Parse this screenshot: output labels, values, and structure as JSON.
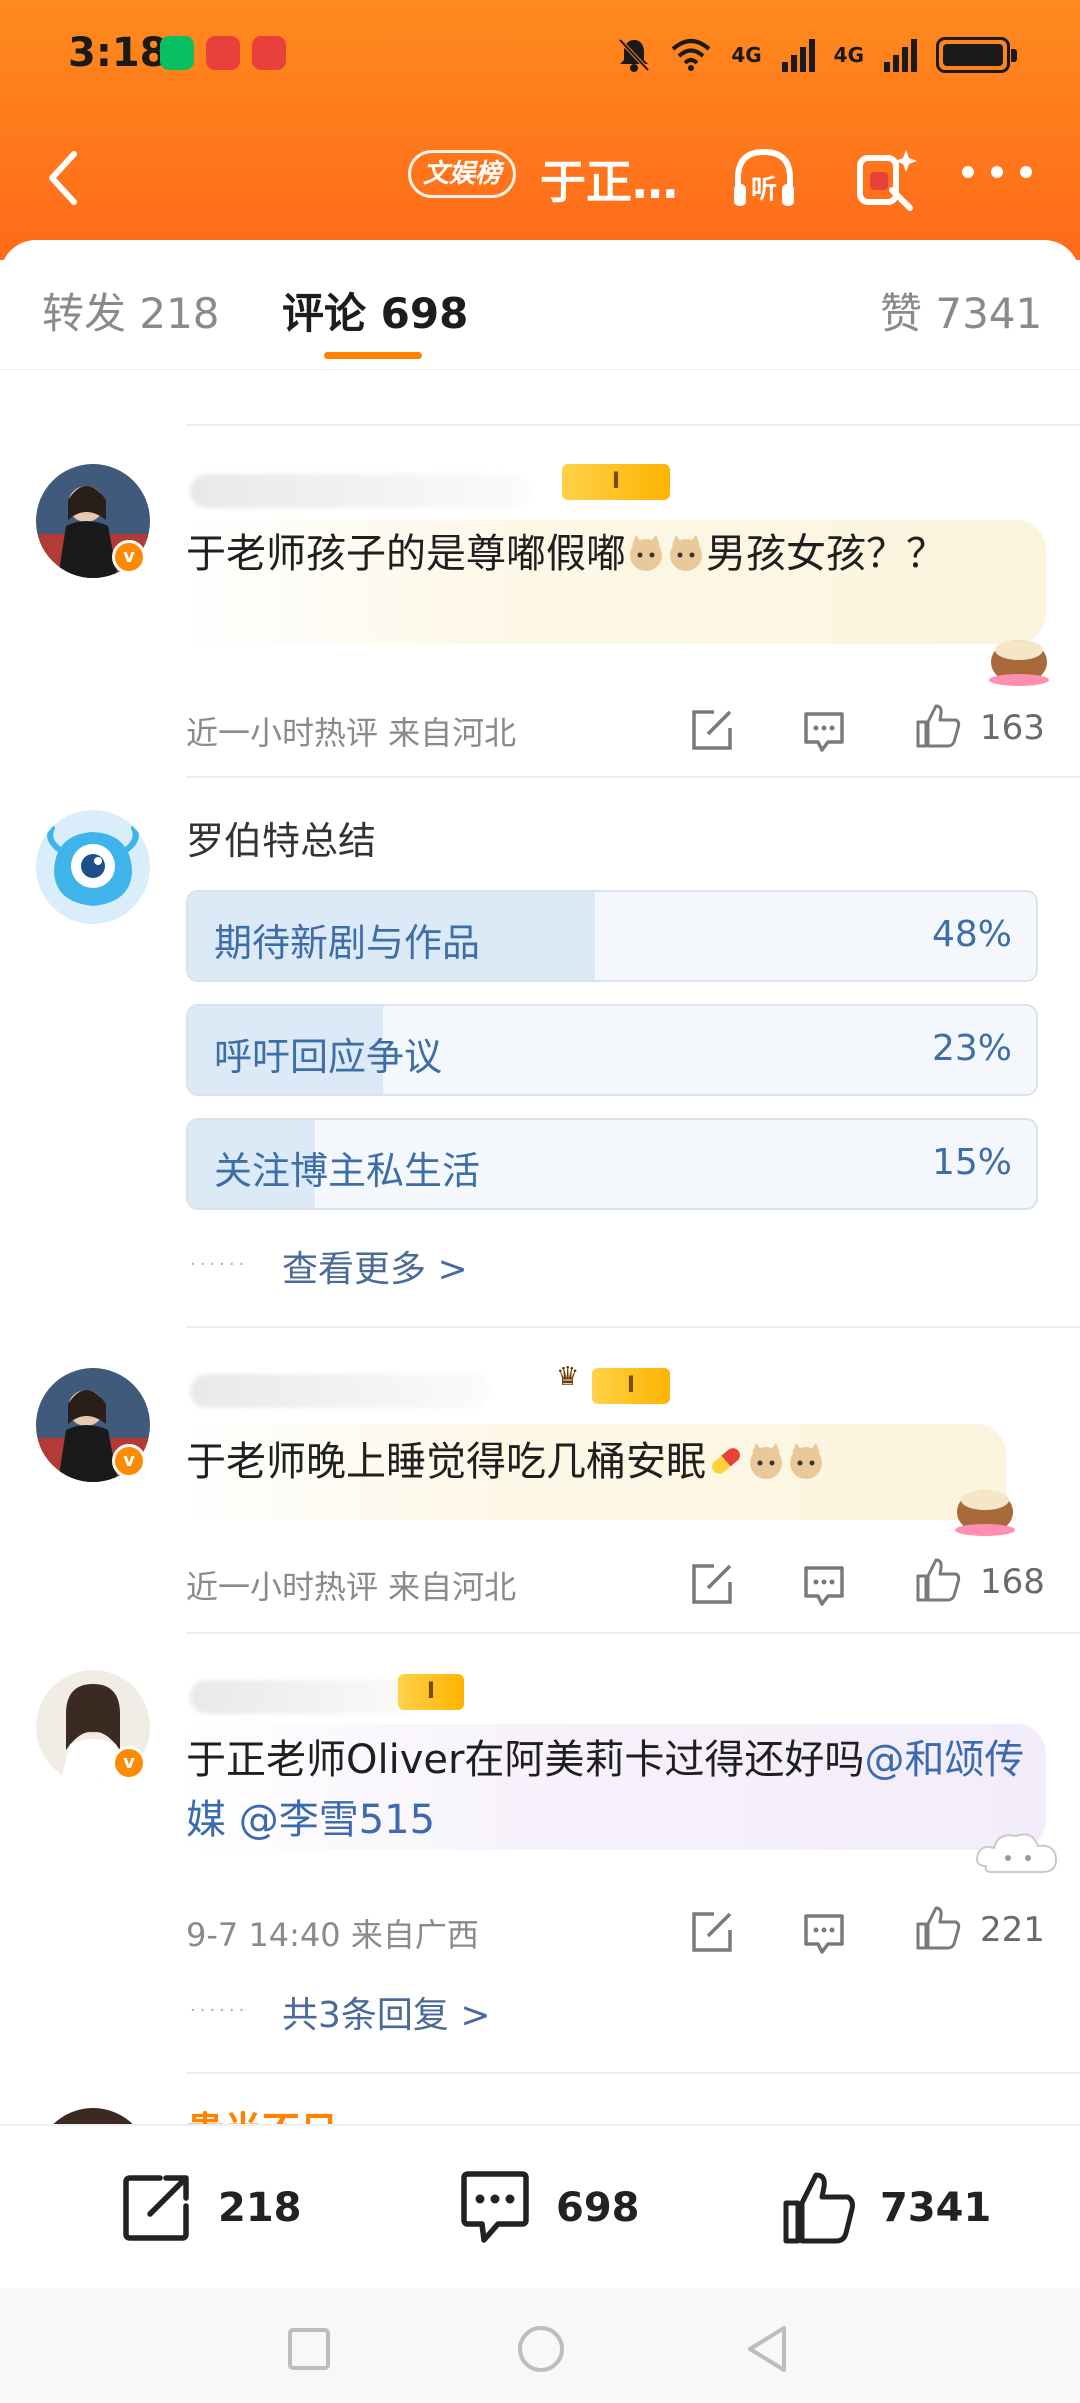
{
  "status_bar": {
    "time": "3:18",
    "net1": "4G",
    "net2": "4G",
    "wifi_label": "6"
  },
  "nav": {
    "channel": "文娱榜",
    "title": "于正…",
    "listen_label": "听"
  },
  "tabs": [
    {
      "label": "转发 218"
    },
    {
      "label": "评论 698"
    },
    {
      "label": "赞 7341"
    }
  ],
  "comments": [
    {
      "text": "于老师孩子的是尊嘟假嘟",
      "text_tail": "男孩女孩？？",
      "meta": "近一小时热评  来自河北",
      "likes": "163"
    },
    {
      "text": "于老师晚上睡觉得吃几桶安眠",
      "meta": "近一小时热评  来自河北",
      "likes": "168"
    },
    {
      "text": "于正老师Oliver在阿美莉卡过得还好吗",
      "mention1": "@和颂传媒",
      "mention2": "@李雪515",
      "meta": "9-7 14:40  来自广西",
      "likes": "221",
      "replies": "共3条回复 >"
    }
  ],
  "poll": {
    "name": "罗伯特总结",
    "options": [
      {
        "label": "期待新剧与作品",
        "pct": "48%",
        "value": 48
      },
      {
        "label": "呼吁回应争议",
        "pct": "23%",
        "value": 23
      },
      {
        "label": "关注博主私生活",
        "pct": "15%",
        "value": 15
      }
    ],
    "more": "查看更多 >"
  },
  "misc": {
    "dots": "······",
    "level": "I",
    "partial_name": "贵半不日"
  },
  "bottom": {
    "repost": "218",
    "comment": "698",
    "like": "7341"
  },
  "colors": {
    "brand_orange": "#ff7a1a",
    "link_blue": "#3d6ea8",
    "accent": "#ff8200"
  }
}
